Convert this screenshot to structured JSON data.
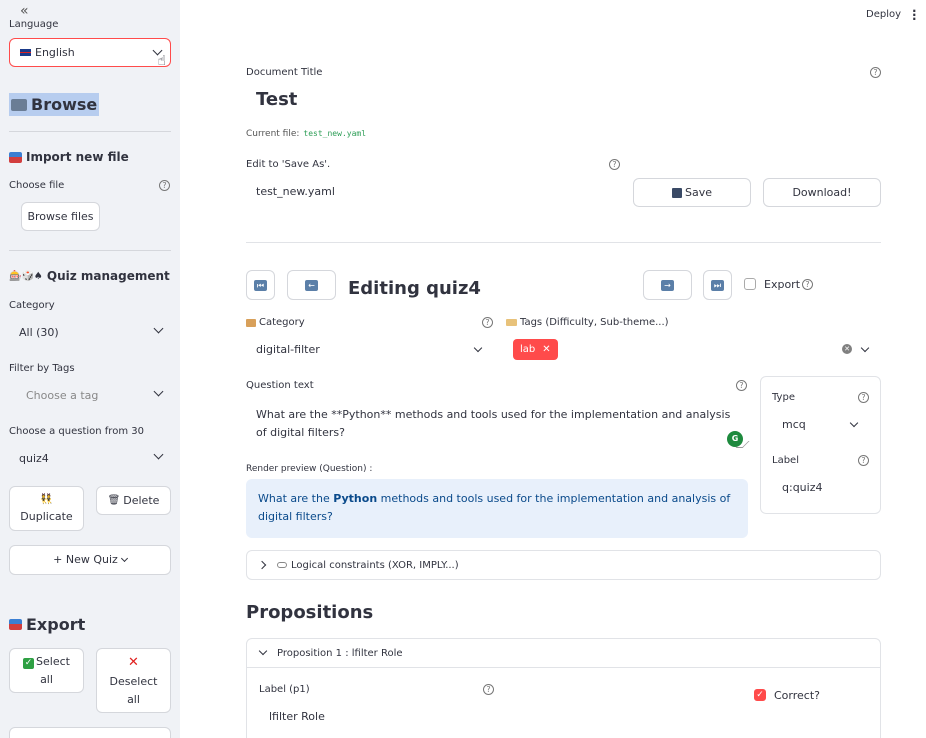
{
  "header": {
    "deploy_label": "Deploy",
    "menu_glyph": "⋮"
  },
  "sidebar": {
    "collapse_glyph": "«",
    "language": {
      "label": "Language",
      "value": "English"
    },
    "browse_title": "Browse",
    "import": {
      "heading": "Import new file",
      "choose_file_label": "Choose file",
      "browse_button": "Browse files"
    },
    "quiz_management": {
      "heading": "Quiz management",
      "heading_emoji": "🎰🎲♠",
      "category_label": "Category",
      "category_value": "All (30)",
      "tags_label": "Filter by Tags",
      "tags_placeholder": "Choose a tag",
      "question_label": "Choose a question from 30",
      "question_value": "quiz4",
      "duplicate_emoji": "👯",
      "duplicate_label": "Duplicate",
      "delete_emoji": "🗑",
      "delete_label": "Delete",
      "new_quiz_label": "+ New Quiz"
    },
    "export": {
      "heading": "Export",
      "select_all_line1": "Select",
      "select_all_line2": "all",
      "deselect_line1": "Deselect",
      "deselect_line2": "all"
    }
  },
  "main": {
    "document_title_label": "Document Title",
    "document_title": "Test",
    "current_file_label": "Current file:",
    "current_file": "test_new.yaml",
    "save_as_label": "Edit to 'Save As'.",
    "save_as_value": "test_new.yaml",
    "save_button": "Save",
    "download_button": "Download!",
    "editing_title": "Editing quiz4",
    "export_label": "Export",
    "category_label": "Category",
    "category_value": "digital-filter",
    "tags_label": "Tags (Difficulty, Sub-theme...)",
    "tag_chip": "lab",
    "question_text_label": "Question text",
    "question_text": "What are the **Python** methods and tools used for the implementation and analysis of digital filters?",
    "render_preview_label": "Render preview (Question) :",
    "preview_before": "What are the ",
    "preview_bold": "Python",
    "preview_after": " methods and tools used for the implementation and analysis of digital filters?",
    "type_label": "Type",
    "type_value": "mcq",
    "label_label": "Label",
    "label_value": "q:quiz4",
    "logic_label": "Logical constraints (XOR, IMPLY...)",
    "propositions_title": "Propositions",
    "proposition_1": {
      "header": "Proposition 1 : lfilter Role",
      "label_label": "Label (p1)",
      "label_value": "lfilter Role",
      "correct_label": "Correct?"
    }
  },
  "colors": {
    "accent": "#ff4b4b",
    "sidebar_bg": "#f0f2f6",
    "preview_bg": "#e8f0fb",
    "preview_text": "#0a4a8b"
  }
}
